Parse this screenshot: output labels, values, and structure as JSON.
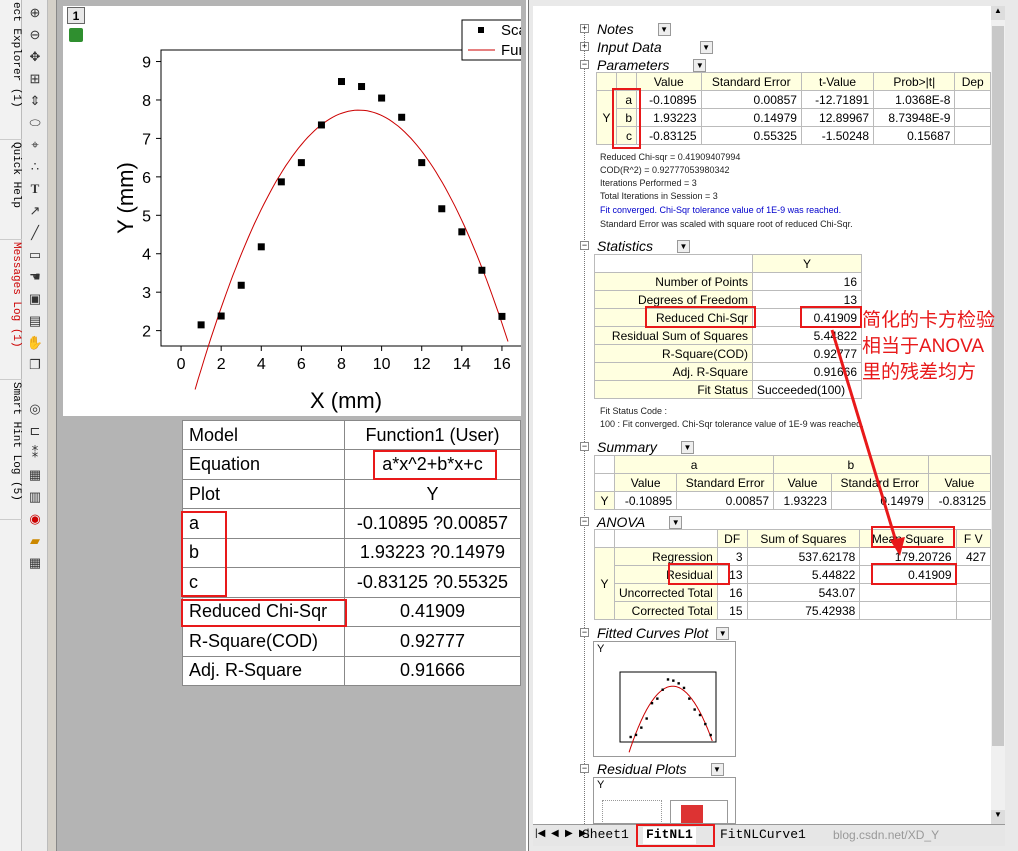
{
  "vertical_panes": [
    {
      "label": "ect Explorer (1)",
      "color": "#000000"
    },
    {
      "label": "Quick Help",
      "color": "#000000"
    },
    {
      "label": "Messages Log (1)",
      "color": "#cc0000"
    },
    {
      "label": "Smart Hint Log (5)",
      "color": "#000000"
    }
  ],
  "graph": {
    "page_number": "1",
    "legend": [
      "Sca",
      "Fur"
    ],
    "xlabel": "X (mm)",
    "ylabel": "Y (mm)",
    "xticks": [
      "0",
      "2",
      "4",
      "6",
      "8",
      "10",
      "12",
      "14",
      "16"
    ],
    "yticks": [
      "2",
      "3",
      "4",
      "5",
      "6",
      "7",
      "8",
      "9"
    ]
  },
  "chart_data": {
    "type": "scatter",
    "xlabel": "X (mm)",
    "ylabel": "Y (mm)",
    "xlim": [
      -1,
      17
    ],
    "ylim": [
      1.6,
      9.3
    ],
    "series": [
      {
        "name": "Sca",
        "x": [
          1,
          2,
          3,
          4,
          5,
          6,
          7,
          8,
          9,
          10,
          11,
          12,
          13,
          14,
          15,
          16
        ],
        "values": [
          2.15,
          2.38,
          3.18,
          4.18,
          5.87,
          6.37,
          7.35,
          8.48,
          8.35,
          8.05,
          7.55,
          6.37,
          5.17,
          4.57,
          3.57,
          2.37
        ]
      },
      {
        "name": "Fur",
        "equation": "a*x^2+b*x+c",
        "a": -0.10895,
        "b": 1.93223,
        "c": -0.83125
      }
    ]
  },
  "result_table": [
    [
      "Model",
      "Function1 (User)"
    ],
    [
      "Equation",
      "a*x^2+b*x+c"
    ],
    [
      "Plot",
      "Y"
    ],
    [
      "a",
      "-0.10895 ?0.00857"
    ],
    [
      "b",
      "1.93223 ?0.14979"
    ],
    [
      "c",
      "-0.83125 ?0.55325"
    ],
    [
      "Reduced Chi-Sqr",
      "0.41909"
    ],
    [
      "R-Square(COD)",
      "0.92777"
    ],
    [
      "Adj. R-Square",
      "0.91666"
    ]
  ],
  "report": {
    "sections": {
      "notes": "Notes",
      "input": "Input Data",
      "params": "Parameters",
      "stats": "Statistics",
      "summary": "Summary",
      "anova": "ANOVA",
      "fitted": "Fitted Curves Plot",
      "residual": "Residual Plots"
    },
    "params_headers": [
      "Value",
      "Standard Error",
      "t-Value",
      "Prob>|t|",
      "Dep"
    ],
    "params_y": "Y",
    "params_rows": [
      [
        "a",
        "-0.10895",
        "0.00857",
        "-12.71891",
        "1.0368E-8"
      ],
      [
        "b",
        "1.93223",
        "0.14979",
        "12.89967",
        "8.73948E-9"
      ],
      [
        "c",
        "-0.83125",
        "0.55325",
        "-1.50248",
        "0.15687"
      ]
    ],
    "fit_notes": [
      "Reduced Chi-sqr = 0.41909407994",
      "COD(R^2) = 0.92777053980342",
      "Iterations Performed = 3",
      "Total Iterations in Session = 3",
      "Fit converged. Chi-Sqr tolerance value of 1E-9 was reached.",
      "Standard Error was scaled with square root of reduced Chi-Sqr."
    ],
    "stats_header": "Y",
    "stats_rows": [
      [
        "Number of Points",
        "16"
      ],
      [
        "Degrees of Freedom",
        "13"
      ],
      [
        "Reduced Chi-Sqr",
        "0.41909"
      ],
      [
        "Residual Sum of Squares",
        "5.44822"
      ],
      [
        "R-Square(COD)",
        "0.92777"
      ],
      [
        "Adj. R-Square",
        "0.91666"
      ],
      [
        "Fit Status",
        "Succeeded(100)"
      ]
    ],
    "fit_status_notes": [
      "Fit Status Code :",
      "100 : Fit converged. Chi-Sqr tolerance value of 1E-9 was reached."
    ],
    "summary_groups": [
      "a",
      "b"
    ],
    "summary_headers": [
      "Value",
      "Standard Error",
      "Value",
      "Standard Error",
      "Value"
    ],
    "summary_row": [
      "Y",
      "-0.10895",
      "0.00857",
      "1.93223",
      "0.14979",
      "-0.83125"
    ],
    "anova_headers": [
      "DF",
      "Sum of Squares",
      "Mean Square",
      "F V"
    ],
    "anova_y": "Y",
    "anova_rows": [
      [
        "Regression",
        "3",
        "537.62178",
        "179.20726",
        "427"
      ],
      [
        "Residual",
        "13",
        "5.44822",
        "0.41909",
        ""
      ],
      [
        "Uncorrected Total",
        "16",
        "543.07",
        "",
        ""
      ],
      [
        "Corrected Total",
        "15",
        "75.42938",
        "",
        ""
      ]
    ],
    "thumb_label": "Y",
    "thumb2_label": "Y"
  },
  "sheet_tabs": [
    "Sheet1",
    "FitNL1",
    "FitNLCurve1"
  ],
  "watermark": "blog.csdn.net/XD_Y",
  "annotation": [
    "简化的卡方检验",
    "相当于ANOVA",
    "里的残差均方"
  ],
  "colors": {
    "highlight": "#e8191a",
    "curve": "#cc0000",
    "header_bg": "#ffffe0"
  }
}
